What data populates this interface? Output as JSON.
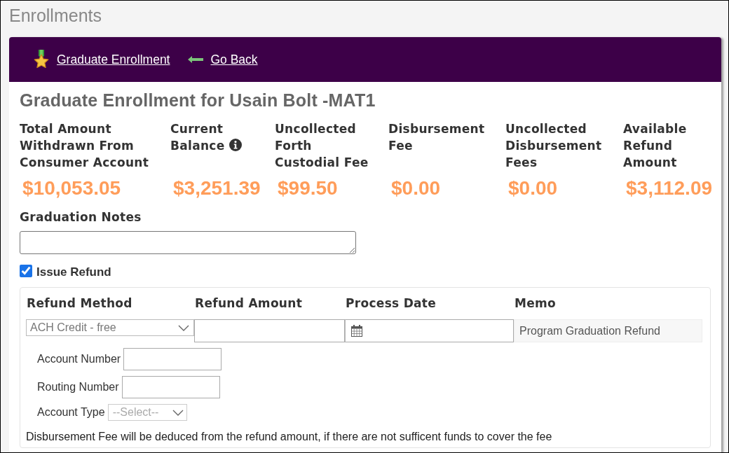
{
  "page": {
    "title": "Enrollments"
  },
  "toolbar": {
    "links": [
      {
        "kind": "graduate",
        "label": "Graduate Enrollment"
      },
      {
        "kind": "back",
        "label": "Go Back"
      }
    ]
  },
  "enrollment": {
    "heading": "Graduate Enrollment for Usain Bolt -MAT1",
    "summary": [
      {
        "label": "Total Amount Withdrawn From Consumer Account",
        "value": "$10,053.05",
        "info": false
      },
      {
        "label": "Current Balance",
        "value": "$3,251.39",
        "info": true
      },
      {
        "label": "Uncollected Forth Custodial Fee",
        "value": "$99.50",
        "info": false
      },
      {
        "label": "Disbursement Fee",
        "value": "$0.00",
        "info": false
      },
      {
        "label": "Uncollected Disbursement Fees",
        "value": "$0.00",
        "info": false
      },
      {
        "label": "Available Refund Amount",
        "value": "$3,112.09",
        "info": false
      }
    ],
    "notes": {
      "label": "Graduation Notes"
    },
    "issue_refund": {
      "label": "Issue Refund",
      "checked": true
    },
    "refund": {
      "columns": [
        {
          "label": "Refund Method",
          "kind": "select",
          "value": "ACH Credit - free"
        },
        {
          "label": "Refund Amount",
          "kind": "text"
        },
        {
          "label": "Process Date",
          "kind": "date"
        },
        {
          "label": "Memo",
          "kind": "readonly",
          "value": "Program Graduation Refund"
        }
      ],
      "bank_fields": [
        {
          "label": "Account Number",
          "kind": "text"
        },
        {
          "label": "Routing Number",
          "kind": "text"
        },
        {
          "label": "Account Type",
          "kind": "select",
          "value": "--Select--"
        }
      ],
      "note": "Disbursement Fee will be deduced from the refund amount, if there are not sufficent funds to cover the fee"
    }
  }
}
